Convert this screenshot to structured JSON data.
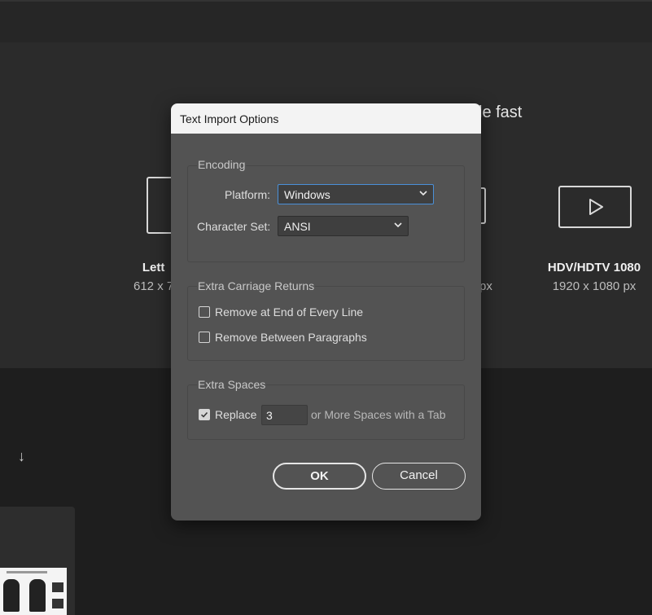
{
  "background": {
    "hero_title": "le fast",
    "presets": [
      {
        "name": "Lett",
        "size": "612 x 7"
      },
      {
        "name": "",
        "size": "px"
      },
      {
        "name": "HDV/HDTV 1080",
        "size": "1920 x 1080 px"
      }
    ],
    "sort_icon": "↓"
  },
  "dialog": {
    "title": "Text Import Options",
    "encoding": {
      "legend": "Encoding",
      "platform_label": "Platform:",
      "platform_value": "Windows",
      "charset_label": "Character Set:",
      "charset_value": "ANSI"
    },
    "carriage": {
      "legend": "Extra Carriage Returns",
      "remove_end_line": {
        "label": "Remove at End of Every Line",
        "checked": false
      },
      "remove_between": {
        "label": "Remove Between Paragraphs",
        "checked": false
      }
    },
    "spaces": {
      "legend": "Extra Spaces",
      "replace_label": "Replace",
      "replace_checked": true,
      "replace_value": "3",
      "suffix": "or More Spaces with a Tab"
    },
    "ok_label": "OK",
    "cancel_label": "Cancel"
  },
  "colors": {
    "focus": "#4a90d9",
    "dialog_bg": "#535353",
    "app_bg": "#1e1e1e"
  }
}
